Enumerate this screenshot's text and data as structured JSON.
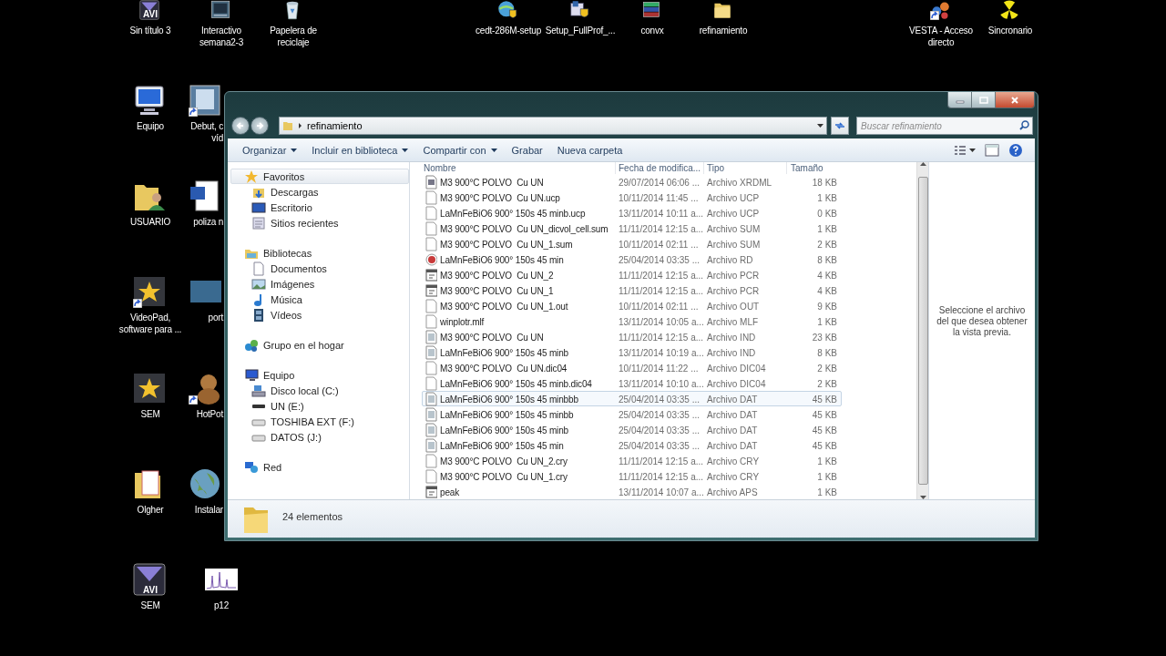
{
  "desktop_icons": [
    {
      "label": "Sin título 3",
      "kind": "avi",
      "badge": "AVI",
      "shortcut": false
    },
    {
      "label": "Interactivo\nsemana2-3",
      "kind": "presentation",
      "shortcut": false
    },
    {
      "label": "Papelera de\nreciclaje",
      "kind": "recycle",
      "shortcut": false
    },
    {
      "label": "cedt-286M-setup",
      "kind": "setup",
      "shortcut": false
    },
    {
      "label": "Setup_FullProf_...",
      "kind": "installer",
      "shortcut": false
    },
    {
      "label": "convx",
      "kind": "archive",
      "shortcut": false
    },
    {
      "label": "refinamiento",
      "kind": "folder",
      "shortcut": false
    },
    {
      "label": "VESTA - Acceso\ndirecto",
      "kind": "molecule",
      "shortcut": true
    },
    {
      "label": "Sincronario",
      "kind": "radiation",
      "shortcut": false
    },
    {
      "label": "Equipo",
      "kind": "computer",
      "shortcut": false
    },
    {
      "label": "Debut, c\nvíd",
      "kind": "video",
      "shortcut": true
    },
    {
      "label": "USUARIO",
      "kind": "user-folder",
      "shortcut": false
    },
    {
      "label": "poliza n",
      "kind": "word",
      "shortcut": false
    },
    {
      "label": "VideoPad,\nsoftware para ...",
      "kind": "star-film",
      "shortcut": true
    },
    {
      "label": "port",
      "kind": "photo",
      "shortcut": false
    },
    {
      "label": "SEM",
      "kind": "star-film",
      "shortcut": false
    },
    {
      "label": "HotPot",
      "kind": "bear",
      "shortcut": true
    },
    {
      "label": "Olgher",
      "kind": "doc-folder",
      "shortcut": false
    },
    {
      "label": "Instalar",
      "kind": "globe",
      "shortcut": false
    },
    {
      "label": "SEM",
      "kind": "avi",
      "badge": "AVI",
      "shortcut": false
    },
    {
      "label": "p12",
      "kind": "spectrum",
      "shortcut": false
    }
  ],
  "explorer": {
    "address": {
      "path": "refinamiento",
      "search_placeholder": "Buscar refinamiento"
    },
    "toolbar": [
      {
        "label": "Organizar",
        "dropdown": true
      },
      {
        "label": "Incluir en biblioteca",
        "dropdown": true
      },
      {
        "label": "Compartir con",
        "dropdown": true
      },
      {
        "label": "Grabar",
        "dropdown": false
      },
      {
        "label": "Nueva carpeta",
        "dropdown": false
      }
    ],
    "sidebar": {
      "groups": [
        {
          "label": "Favoritos",
          "kind": "star",
          "selected": true,
          "children": [
            {
              "label": "Descargas",
              "kind": "downloads",
              "selected": false
            },
            {
              "label": "Escritorio",
              "kind": "desktop",
              "selected": false
            },
            {
              "label": "Sitios recientes",
              "kind": "recent",
              "selected": false
            }
          ]
        },
        {
          "label": "Bibliotecas",
          "kind": "library",
          "selected": false,
          "children": [
            {
              "label": "Documentos",
              "kind": "document",
              "selected": false
            },
            {
              "label": "Imágenes",
              "kind": "pictures",
              "selected": false
            },
            {
              "label": "Música",
              "kind": "music",
              "selected": false
            },
            {
              "label": "Vídeos",
              "kind": "videos",
              "selected": false
            }
          ]
        },
        {
          "label": "Grupo en el hogar",
          "kind": "homegroup",
          "selected": false
        },
        {
          "label": "Equipo",
          "kind": "computer",
          "selected": false,
          "children": [
            {
              "label": "Disco local (C:)",
              "kind": "system-drive",
              "selected": false
            },
            {
              "label": "UN (E:)",
              "kind": "drive",
              "selected": false
            },
            {
              "label": "TOSHIBA EXT (F:)",
              "kind": "external",
              "selected": false
            },
            {
              "label": "DATOS (J:)",
              "kind": "external",
              "selected": false
            }
          ]
        },
        {
          "label": "Red",
          "kind": "network",
          "selected": false
        }
      ]
    },
    "file_list": {
      "columns": [
        "Nombre",
        "Fecha de modifica...",
        "Tipo",
        "Tamaño"
      ],
      "rows": [
        {
          "name": "M3 900°C POLVO  Cu UN",
          "date": "29/07/2014 06:06 ...",
          "type": "Archivo XRDML",
          "size": "18 KB",
          "kind": "app",
          "selected": false
        },
        {
          "name": "M3 900°C POLVO  Cu UN.ucp",
          "date": "10/11/2014 11:45 ...",
          "type": "Archivo UCP",
          "size": "1 KB",
          "kind": "blank",
          "selected": false
        },
        {
          "name": "LaMnFeBiO6 900° 150s 45 minb.ucp",
          "date": "13/11/2014 10:11 a...",
          "type": "Archivo UCP",
          "size": "0 KB",
          "kind": "blank",
          "selected": false
        },
        {
          "name": "M3 900°C POLVO  Cu UN_dicvol_cell.sum",
          "date": "11/11/2014 12:15 a...",
          "type": "Archivo SUM",
          "size": "1 KB",
          "kind": "blank",
          "selected": false
        },
        {
          "name": "M3 900°C POLVO  Cu UN_1.sum",
          "date": "10/11/2014 02:11 ...",
          "type": "Archivo SUM",
          "size": "2 KB",
          "kind": "blank",
          "selected": false
        },
        {
          "name": "LaMnFeBiO6 900° 150s 45 min",
          "date": "25/04/2014 03:35 ...",
          "type": "Archivo RD",
          "size": "8 KB",
          "kind": "red",
          "selected": false
        },
        {
          "name": "M3 900°C POLVO  Cu UN_2",
          "date": "11/11/2014 12:15 a...",
          "type": "Archivo PCR",
          "size": "4 KB",
          "kind": "program",
          "selected": false
        },
        {
          "name": "M3 900°C POLVO  Cu UN_1",
          "date": "11/11/2014 12:15 a...",
          "type": "Archivo PCR",
          "size": "4 KB",
          "kind": "program",
          "selected": false
        },
        {
          "name": "M3 900°C POLVO  Cu UN_1.out",
          "date": "10/11/2014 02:11 ...",
          "type": "Archivo OUT",
          "size": "9 KB",
          "kind": "blank",
          "selected": false
        },
        {
          "name": "winplotr.mlf",
          "date": "13/11/2014 10:05 a...",
          "type": "Archivo MLF",
          "size": "1 KB",
          "kind": "blank",
          "selected": false
        },
        {
          "name": "M3 900°C POLVO  Cu UN",
          "date": "11/11/2014 12:15 a...",
          "type": "Archivo IND",
          "size": "23 KB",
          "kind": "data",
          "selected": false
        },
        {
          "name": "LaMnFeBiO6 900° 150s 45 minb",
          "date": "13/11/2014 10:19 a...",
          "type": "Archivo IND",
          "size": "8 KB",
          "kind": "data",
          "selected": false
        },
        {
          "name": "M3 900°C POLVO  Cu UN.dic04",
          "date": "10/11/2014 11:22 ...",
          "type": "Archivo DIC04",
          "size": "2 KB",
          "kind": "blank",
          "selected": false
        },
        {
          "name": "LaMnFeBiO6 900° 150s 45 minb.dic04",
          "date": "13/11/2014 10:10 a...",
          "type": "Archivo DIC04",
          "size": "2 KB",
          "kind": "blank",
          "selected": false
        },
        {
          "name": "LaMnFeBiO6 900° 150s 45 minbbb",
          "date": "25/04/2014 03:35 ...",
          "type": "Archivo DAT",
          "size": "45 KB",
          "kind": "data",
          "selected": true
        },
        {
          "name": "LaMnFeBiO6 900° 150s 45 minbb",
          "date": "25/04/2014 03:35 ...",
          "type": "Archivo DAT",
          "size": "45 KB",
          "kind": "data",
          "selected": false
        },
        {
          "name": "LaMnFeBiO6 900° 150s 45 minb",
          "date": "25/04/2014 03:35 ...",
          "type": "Archivo DAT",
          "size": "45 KB",
          "kind": "data",
          "selected": false
        },
        {
          "name": "LaMnFeBiO6 900° 150s 45 min",
          "date": "25/04/2014 03:35 ...",
          "type": "Archivo DAT",
          "size": "45 KB",
          "kind": "data",
          "selected": false
        },
        {
          "name": "M3 900°C POLVO  Cu UN_2.cry",
          "date": "11/11/2014 12:15 a...",
          "type": "Archivo CRY",
          "size": "1 KB",
          "kind": "blank",
          "selected": false
        },
        {
          "name": "M3 900°C POLVO  Cu UN_1.cry",
          "date": "11/11/2014 12:15 a...",
          "type": "Archivo CRY",
          "size": "1 KB",
          "kind": "blank",
          "selected": false
        },
        {
          "name": "peak",
          "date": "13/11/2014 10:07 a...",
          "type": "Archivo APS",
          "size": "1 KB",
          "kind": "program",
          "selected": false
        }
      ]
    },
    "preview_message": "Seleccione el archivo del que desea obtener la vista previa.",
    "details": {
      "count": "24 elementos"
    }
  }
}
